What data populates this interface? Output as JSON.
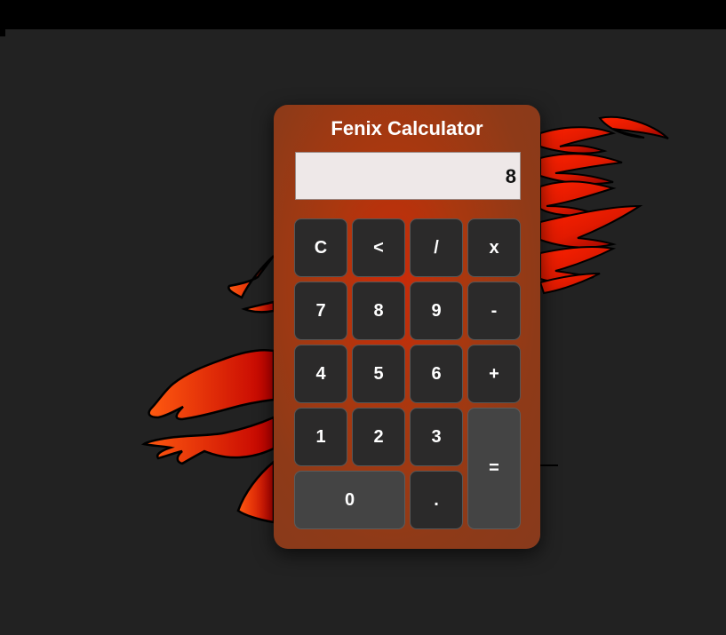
{
  "calculator": {
    "title": "Fenix Calculator",
    "display_value": "8",
    "keys": {
      "clear": "C",
      "backspace": "<",
      "divide": "/",
      "multiply": "x",
      "seven": "7",
      "eight": "8",
      "nine": "9",
      "subtract": "-",
      "four": "4",
      "five": "5",
      "six": "6",
      "add": "+",
      "one": "1",
      "two": "2",
      "three": "3",
      "equals": "=",
      "zero": "0",
      "decimal": "."
    }
  },
  "colors": {
    "page_background": "#222222",
    "calculator_body": "#8e3a18",
    "key_background": "#2b2a2a",
    "key_light_background": "#444444",
    "display_background": "#eee8e8",
    "phoenix_red": "#e11a00"
  },
  "background": {
    "decoration": "phoenix-illustration"
  }
}
